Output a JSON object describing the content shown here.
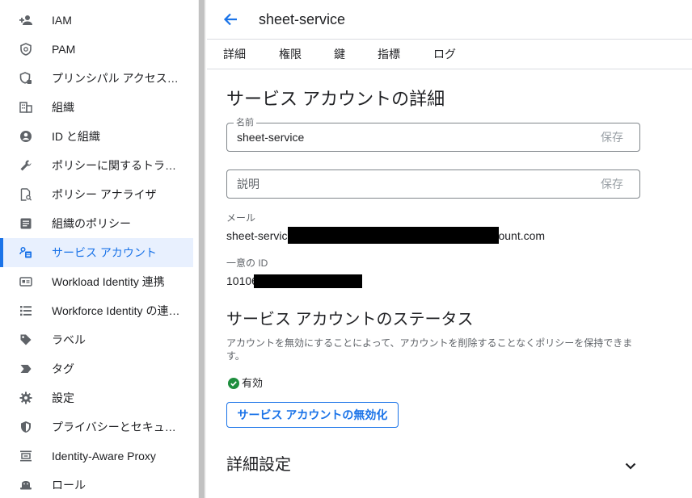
{
  "sidebar": {
    "items": [
      {
        "label": "IAM",
        "icon": "person-add-icon"
      },
      {
        "label": "PAM",
        "icon": "shield-clock-icon"
      },
      {
        "label": "プリンシパル アクセス…",
        "icon": "shield-lock-icon"
      },
      {
        "label": "組織",
        "icon": "building-icon"
      },
      {
        "label": "ID と組織",
        "icon": "account-circle-icon"
      },
      {
        "label": "ポリシーに関するトラ…",
        "icon": "wrench-icon"
      },
      {
        "label": "ポリシー アナライザ",
        "icon": "doc-search-icon"
      },
      {
        "label": "組織のポリシー",
        "icon": "list-doc-icon"
      },
      {
        "label": "サービス アカウント",
        "icon": "service-account-icon",
        "active": true
      },
      {
        "label": "Workload Identity 連携",
        "icon": "id-card-icon"
      },
      {
        "label": "Workforce Identity の連…",
        "icon": "list-icon"
      },
      {
        "label": "ラベル",
        "icon": "tag-icon"
      },
      {
        "label": "タグ",
        "icon": "chevron-tag-icon"
      },
      {
        "label": "設定",
        "icon": "gear-icon"
      },
      {
        "label": "プライバシーとセキュ…",
        "icon": "shield-half-icon"
      },
      {
        "label": "Identity-Aware Proxy",
        "icon": "proxy-icon"
      },
      {
        "label": "ロール",
        "icon": "hat-icon"
      }
    ]
  },
  "header": {
    "title": "sheet-service"
  },
  "tabs": [
    "詳細",
    "権限",
    "鍵",
    "指標",
    "ログ"
  ],
  "details": {
    "section_title": "サービス アカウントの詳細",
    "name_legend": "名前",
    "name_value": "sheet-service",
    "save_label": "保存",
    "description_placeholder": "説明",
    "email_label": "メール",
    "email_prefix": "sheet-servic",
    "email_suffix": "ount.com",
    "unique_id_label": "一意の ID",
    "unique_id_prefix": "10106"
  },
  "status": {
    "section_title": "サービス アカウントのステータス",
    "description": "アカウントを無効にすることによって、アカウントを削除することなくポリシーを保持できます。",
    "state": "有効",
    "disable_button": "サービス アカウントの無効化"
  },
  "advanced": {
    "title": "詳細設定"
  },
  "colors": {
    "accent": "#1a73e8",
    "active_bg": "#e8f0fe",
    "success": "#1e8e3e"
  }
}
